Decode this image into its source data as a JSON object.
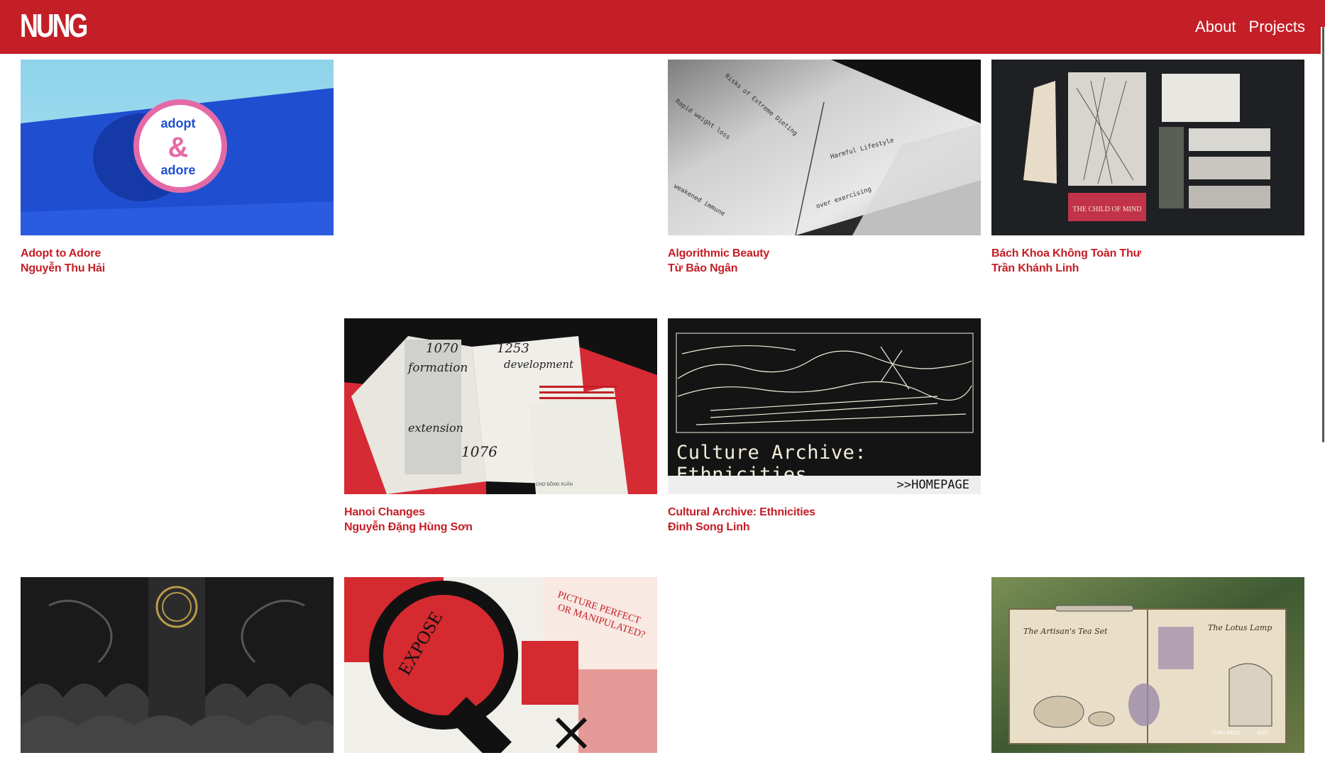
{
  "header": {
    "logo": "NUNG",
    "nav": [
      {
        "label": "About"
      },
      {
        "label": "Projects"
      }
    ]
  },
  "projects": [
    {
      "title": "Adopt to Adore",
      "author": "Nguyễn Thu Hải",
      "image_text": [
        "adopt",
        "&",
        "adore"
      ]
    },
    {
      "title": "Algorithmic Beauty",
      "author": "Từ Bảo Ngân",
      "image_text": [
        "Risks of Extreme Dieting",
        "Rapid weight loss",
        "weakened immune",
        "over exercising",
        "Harmful Lifestyle"
      ]
    },
    {
      "title": "Bách Khoa Không Toàn Thư",
      "author": "Trần Khánh Linh",
      "image_text": [
        "THE CHILD OF MIND"
      ]
    },
    {
      "title": "Hanoi Changes",
      "author": "Nguyễn Đặng Hùng Sơn",
      "image_text": [
        "1070",
        "formation",
        "1253",
        "development",
        "extension",
        "1076",
        "CHỢ ĐỒNG XUÂN"
      ]
    },
    {
      "title": "Cultural Archive: Ethnicities",
      "author": "Đinh Song Linh",
      "image_text": [
        "Culture Archive: Ethnicities",
        ">>HOMEPAGE"
      ]
    },
    {
      "title": "",
      "author": "",
      "image_text": []
    },
    {
      "title": "",
      "author": "",
      "image_text": [
        "PICTURE PERFECT OR MANIPULATED?",
        "EXPOSE"
      ]
    },
    {
      "title": "",
      "author": "",
      "image_text": [
        "The Artisan's Tea Set",
        "The Lotus Lamp",
        "TURN PAGE",
        "EXIT"
      ]
    }
  ],
  "colors": {
    "brand": "#c41e26",
    "text_on_brand": "#ffffff"
  }
}
